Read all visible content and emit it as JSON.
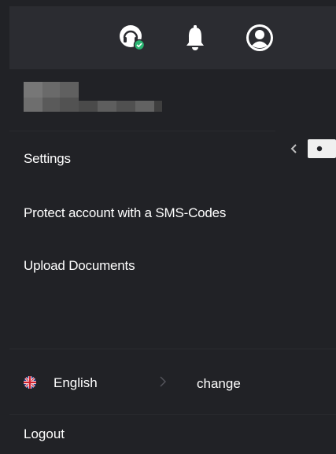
{
  "header": {
    "icons": [
      "headset-icon",
      "bell-icon",
      "user-icon"
    ]
  },
  "menu": {
    "items": [
      {
        "label": "Settings"
      },
      {
        "label": "Protect account with a SMS-Codes"
      },
      {
        "label": "Upload Documents"
      }
    ]
  },
  "language": {
    "current": "English",
    "action_label": "change"
  },
  "logout_label": "Logout",
  "colors": {
    "background": "#212226",
    "topbar": "#2b2c31",
    "text": "#ffffff",
    "icon": "#ffffff",
    "status_ok": "#2bb673"
  }
}
